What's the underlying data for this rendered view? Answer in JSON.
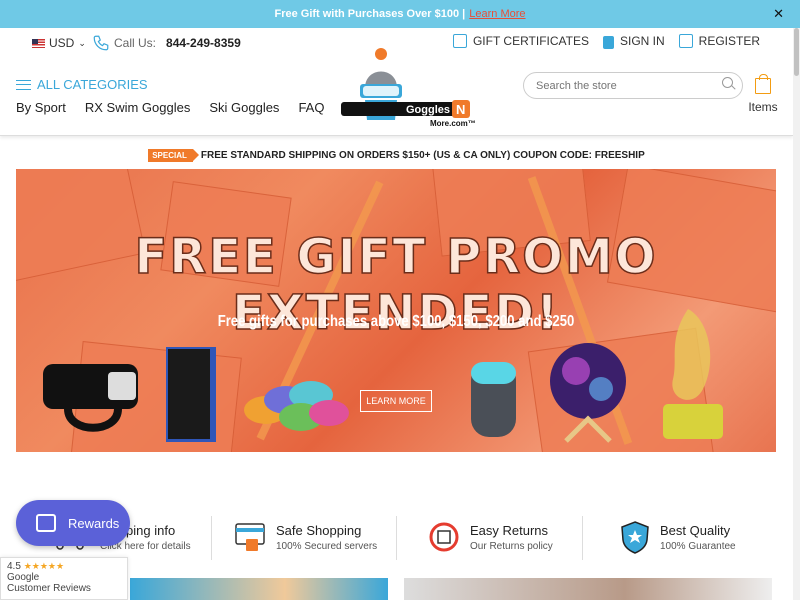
{
  "topbar": {
    "text": "Free Gift with Purchases Over $100 |",
    "link": "Learn More",
    "close": "✕"
  },
  "header": {
    "currency": "USD",
    "call_label": "Call Us:",
    "phone": "844-249-8359",
    "gift_certificates": "GIFT CERTIFICATES",
    "sign_in": "SIGN IN",
    "register": "REGISTER",
    "all_categories": "ALL CATEGORIES",
    "nav": [
      "By Sport",
      "RX Swim Goggles",
      "Ski Goggles",
      "FAQ"
    ],
    "logo_text": "Goggles",
    "logo_badge": "N",
    "logo_sub": "More.com™",
    "search_placeholder": "Search the store",
    "cart_label": "Items"
  },
  "shipping": {
    "badge": "SPECIAL",
    "text": "FREE STANDARD SHIPPING ON ORDERS $150+ (US & CA ONLY) COUPON CODE: FREESHIP"
  },
  "banner": {
    "title": "FREE GIFT PROMO EXTENDED!",
    "subtitle": "Free gifts for purchases above $100, $150, $200 and $250",
    "button": "LEARN MORE"
  },
  "features": [
    {
      "title": "Shipping info",
      "sub": "Click here for details",
      "icon": "truck-icon"
    },
    {
      "title": "Safe Shopping",
      "sub": "100% Secured servers",
      "icon": "secure-card-icon"
    },
    {
      "title": "Easy Returns",
      "sub": "Our Returns policy",
      "icon": "returns-icon"
    },
    {
      "title": "Best Quality",
      "sub": "100% Guarantee",
      "icon": "shield-star-icon"
    }
  ],
  "rewards": {
    "label": "Rewards"
  },
  "google_review": {
    "rating": "4.5",
    "stars": "★★★★★",
    "brand": "Google",
    "label": "Customer Reviews"
  },
  "colors": {
    "accent": "#3aa7d9",
    "topbar": "#6fc9e6",
    "orange": "#f07a2a",
    "rewards": "#5b61d8"
  }
}
